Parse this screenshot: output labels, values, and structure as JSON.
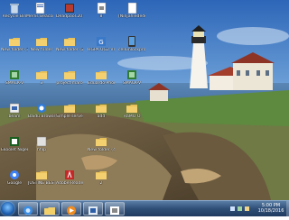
{
  "desktop": {
    "icons": [
      {
        "label": "Recycle Bin",
        "icon": "recycle-bin-icon"
      },
      {
        "label": "Merlis Beacon Teaches Yy...",
        "icon": "document-icon"
      },
      {
        "label": "Deadpool.2018...",
        "icon": "video-file-icon"
      },
      {
        "label": "8",
        "icon": "file-icon"
      },
      {
        "label": "[Ninjahledede]...",
        "icon": "file-icon"
      },
      {
        "label": "New folder (3)",
        "icon": "folder-icon"
      },
      {
        "label": "New folder",
        "icon": "folder-icon"
      },
      {
        "label": "New folder (2)",
        "icon": "folder-icon"
      },
      {
        "label": "HGPA UG2 VISIBRT",
        "icon": "app-icon"
      },
      {
        "label": "cellunlockpro v2023",
        "icon": "app-icon"
      },
      {
        "label": "SMACK-V",
        "icon": "app-icon"
      },
      {
        "label": "3",
        "icon": "folder-icon"
      },
      {
        "label": "project maro",
        "icon": "folder-icon"
      },
      {
        "label": "Eduardo Phones...",
        "icon": "folder-icon"
      },
      {
        "label": "SMACK-V",
        "icon": "app-icon"
      },
      {
        "label": "beam",
        "icon": "app-icon"
      },
      {
        "label": "Baidu Browser",
        "icon": "browser-icon"
      },
      {
        "label": "Simple server",
        "icon": "folder-icon"
      },
      {
        "label": "add",
        "icon": "folder-icon"
      },
      {
        "label": "HaMO O",
        "icon": "folder-icon"
      },
      {
        "label": "Ekoolet Nigeria",
        "icon": "app-icon"
      },
      {
        "label": "hhlp",
        "icon": "app-icon"
      },
      {
        "label": "New folder (4)",
        "icon": "folder-icon"
      },
      {
        "label": "Google",
        "icon": "browser-icon"
      },
      {
        "label": "JUSTINE BEST SONGS",
        "icon": "folder-icon"
      },
      {
        "label": "Adobe Reader 9",
        "icon": "pdf-icon"
      },
      {
        "label": "2",
        "icon": "folder-icon"
      }
    ]
  },
  "taskbar": {
    "time": "5:00 PM",
    "date": "10/18/2016",
    "items": [
      {
        "name": "start-button"
      },
      {
        "name": "internet-explorer-icon"
      },
      {
        "name": "windows-explorer-icon"
      },
      {
        "name": "media-player-icon"
      },
      {
        "name": "app-icon"
      },
      {
        "name": "app-icon"
      }
    ]
  }
}
